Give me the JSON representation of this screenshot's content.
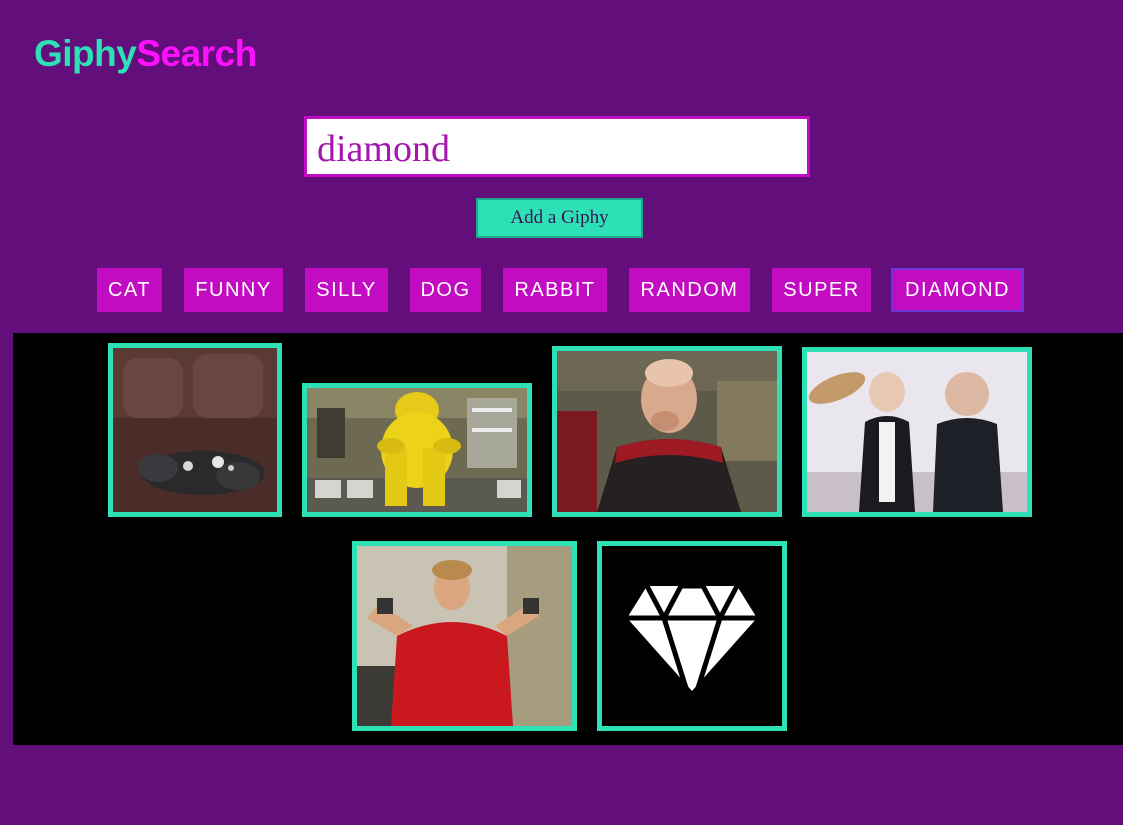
{
  "header": {
    "logo_part1": "Giphy",
    "logo_part2": "Search"
  },
  "search": {
    "value": "diamond",
    "add_button_label": "Add a Giphy"
  },
  "tags": [
    {
      "label": "CAT"
    },
    {
      "label": "FUNNY"
    },
    {
      "label": "SILLY"
    },
    {
      "label": "DOG"
    },
    {
      "label": "RABBIT"
    },
    {
      "label": "RANDOM"
    },
    {
      "label": "SUPER"
    },
    {
      "label": "DIAMOND",
      "active": true
    }
  ],
  "results": {
    "gifs": [
      {
        "name": "gif-fluffy-dog-on-leather-chair"
      },
      {
        "name": "gif-person-in-yellow-hazmat-suit"
      },
      {
        "name": "gif-captain-laughing"
      },
      {
        "name": "gif-elderly-couple-with-burrito"
      },
      {
        "name": "gif-man-in-red-shirt-flexing"
      },
      {
        "name": "gif-white-diamond-icon"
      }
    ]
  },
  "colors": {
    "background": "#620e7b",
    "accent_teal": "#2ee0b6",
    "accent_magenta": "#c20cc2",
    "logo_pink": "#ff10ff",
    "results_background": "#000000"
  }
}
